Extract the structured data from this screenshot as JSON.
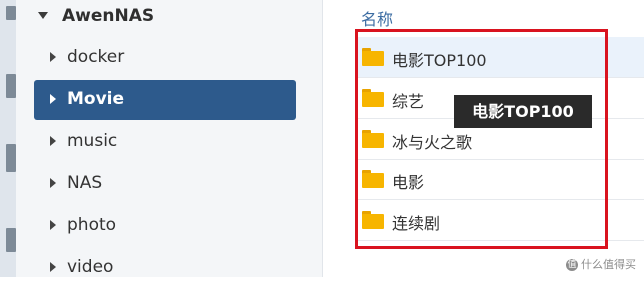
{
  "tree": {
    "root_label": "AwenNAS",
    "items": [
      {
        "label": "docker",
        "selected": false
      },
      {
        "label": "Movie",
        "selected": true
      },
      {
        "label": "music",
        "selected": false
      },
      {
        "label": "NAS",
        "selected": false
      },
      {
        "label": "photo",
        "selected": false
      },
      {
        "label": "video",
        "selected": false
      }
    ]
  },
  "file_list": {
    "column_header": "名称",
    "rows": [
      {
        "name": "电影TOP100",
        "icon": "folder-icon"
      },
      {
        "name": "综艺",
        "icon": "folder-icon"
      },
      {
        "name": "冰与火之歌",
        "icon": "folder-icon"
      },
      {
        "name": "电影",
        "icon": "folder-icon"
      },
      {
        "name": "连续剧",
        "icon": "folder-icon"
      }
    ]
  },
  "tooltip": {
    "text": "电影TOP100"
  },
  "watermark": {
    "badge": "值",
    "text": "什么值得买"
  },
  "colors": {
    "selected_bg": "#2d5a8c",
    "highlight_border": "#d9131f",
    "folder": "#f7b500",
    "header_text": "#3d6da3"
  }
}
